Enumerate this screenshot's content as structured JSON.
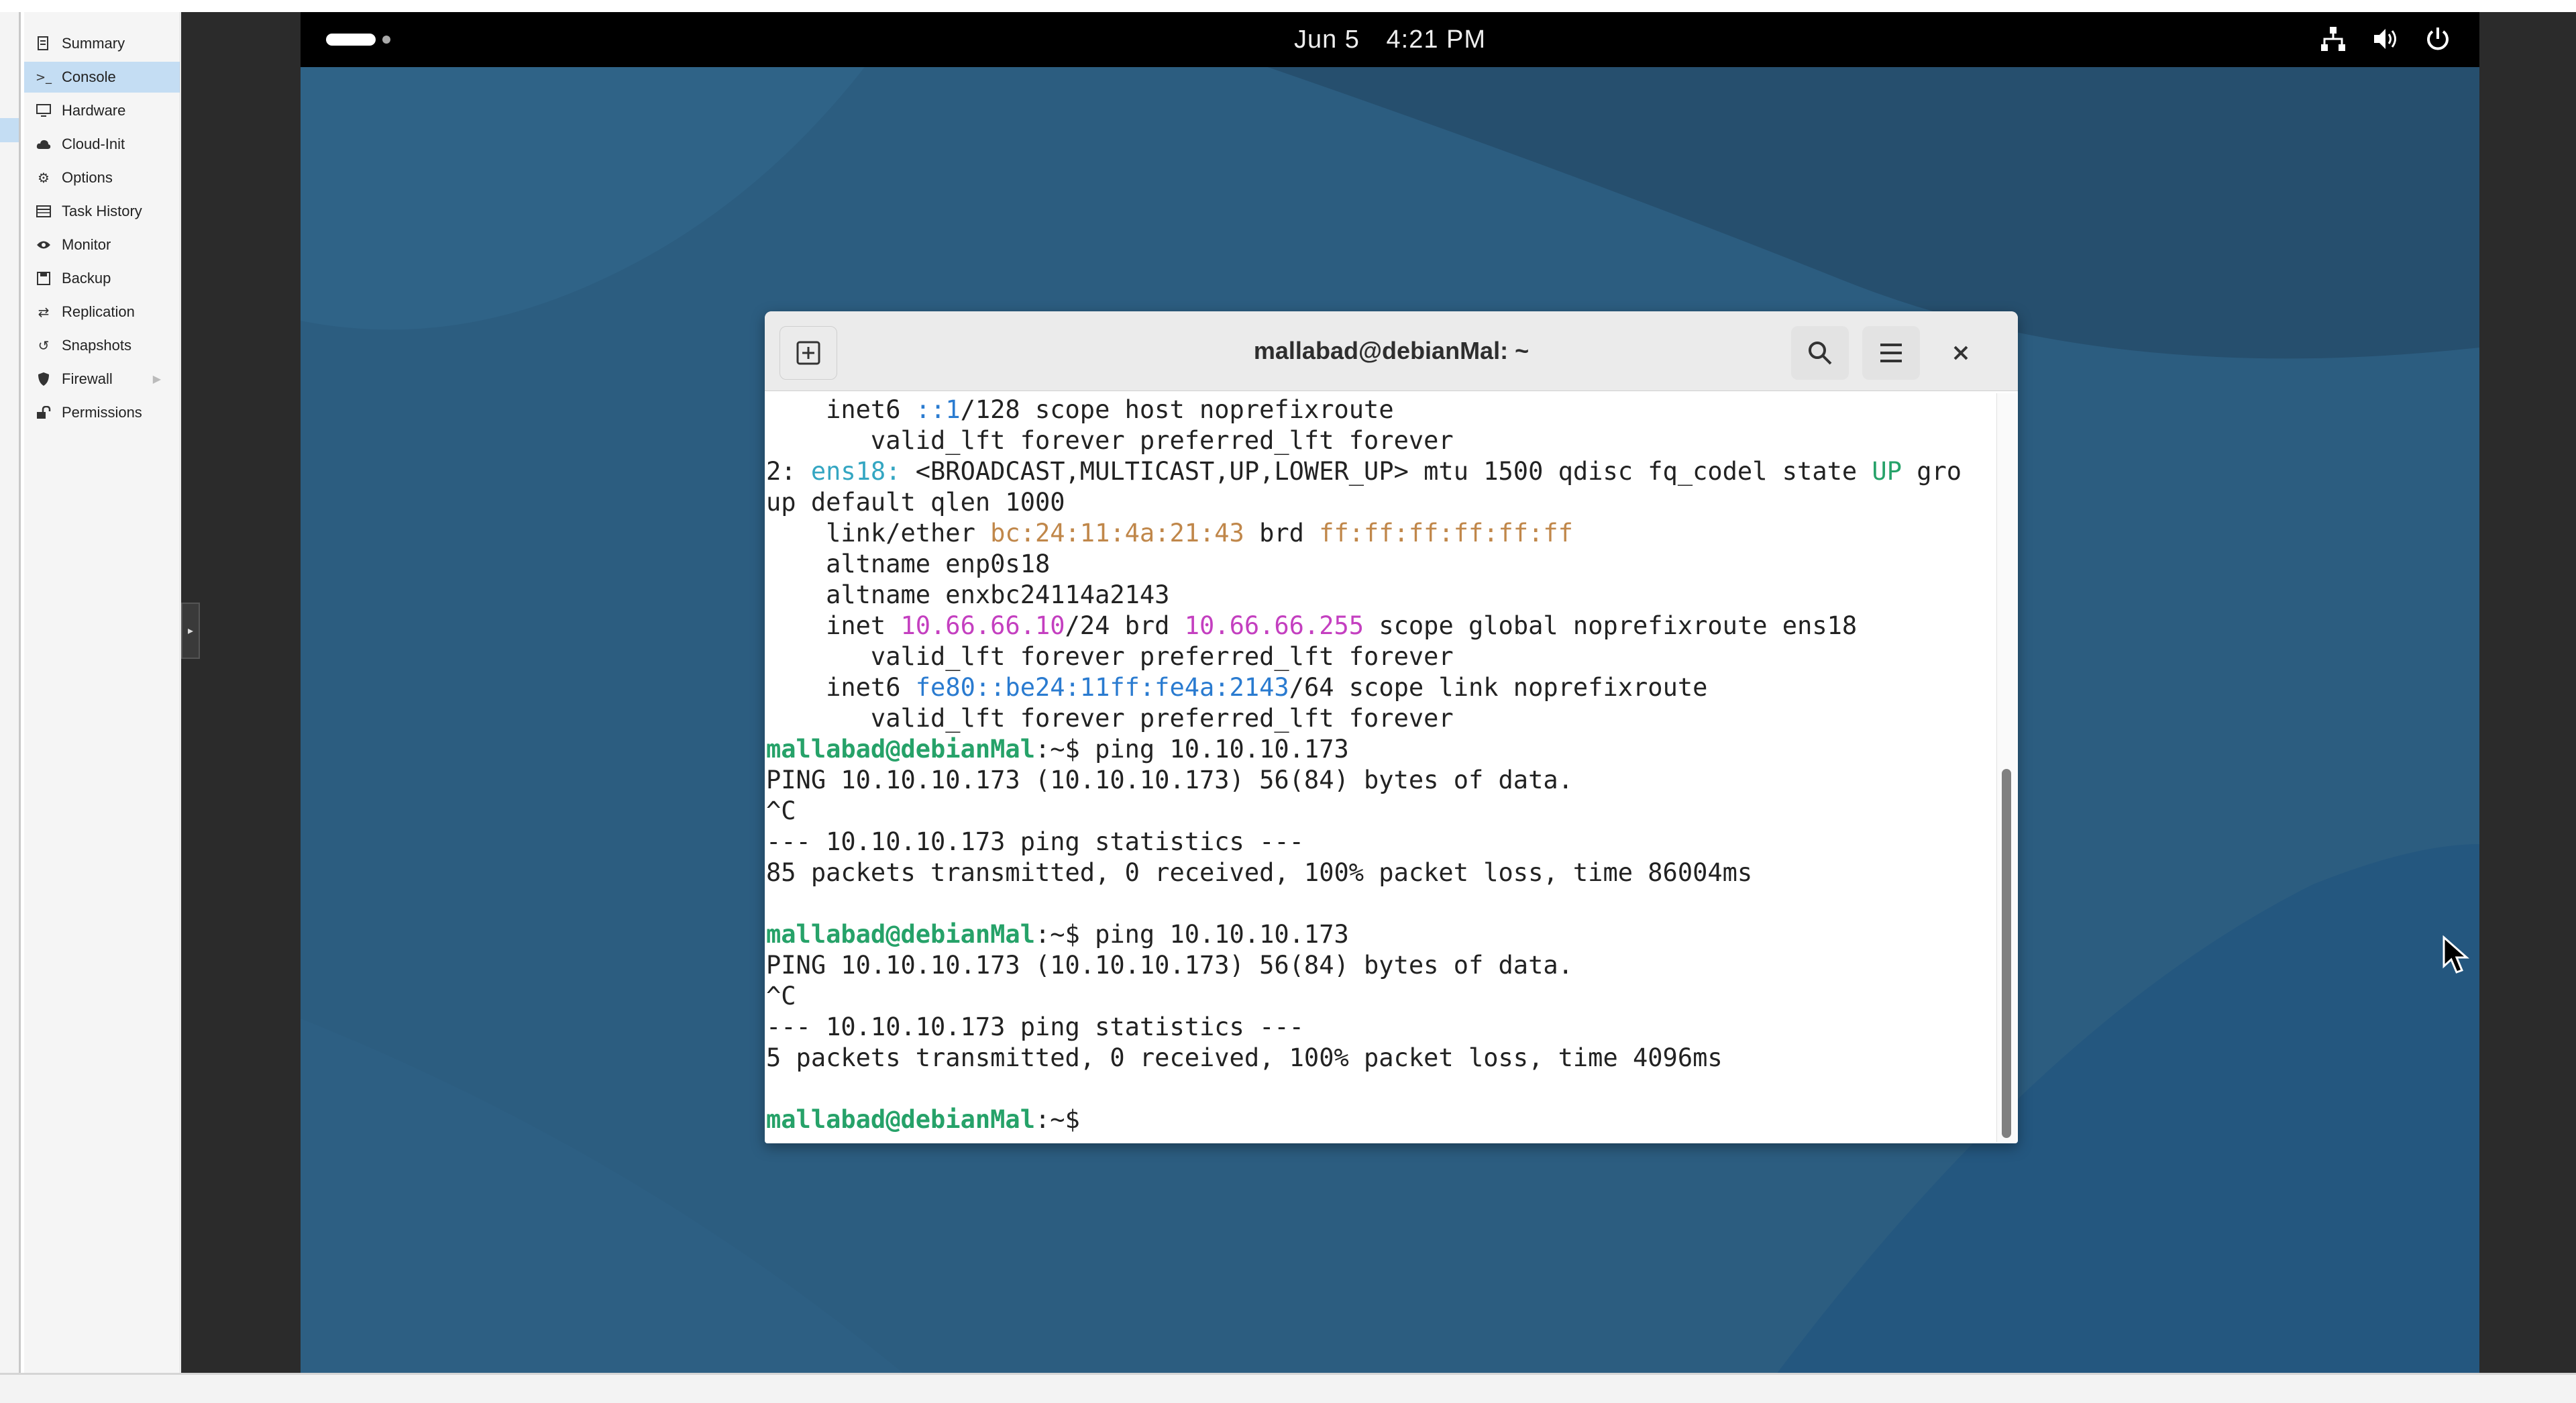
{
  "sidebar": {
    "items": [
      {
        "label": "Summary",
        "icon": "document-icon"
      },
      {
        "label": "Console",
        "icon": "terminal-icon",
        "active": true
      },
      {
        "label": "Hardware",
        "icon": "monitor-icon"
      },
      {
        "label": "Cloud-Init",
        "icon": "cloud-icon"
      },
      {
        "label": "Options",
        "icon": "gear-icon"
      },
      {
        "label": "Task History",
        "icon": "list-icon"
      },
      {
        "label": "Monitor",
        "icon": "eye-icon"
      },
      {
        "label": "Backup",
        "icon": "floppy-icon"
      },
      {
        "label": "Replication",
        "icon": "sync-icon"
      },
      {
        "label": "Snapshots",
        "icon": "history-icon"
      },
      {
        "label": "Firewall",
        "icon": "shield-icon"
      },
      {
        "label": "Permissions",
        "icon": "unlock-icon"
      }
    ]
  },
  "topbar": {
    "date": "Jun 5",
    "time": "4:21 PM"
  },
  "terminal": {
    "title": "mallabad@debianMal: ~",
    "prompt_user": "mallabad@debianMal",
    "prompt_path": ":~$",
    "lines": [
      [
        {
          "t": "    inet6 ",
          "c": "def"
        },
        {
          "t": "::1",
          "c": "blue"
        },
        {
          "t": "/128 scope host noprefixroute",
          "c": "def"
        }
      ],
      [
        {
          "t": "       valid_lft forever preferred_lft forever",
          "c": "def"
        }
      ],
      [
        {
          "t": "2: ",
          "c": "def"
        },
        {
          "t": "ens18:",
          "c": "cyan"
        },
        {
          "t": " <BROADCAST,MULTICAST,UP,LOWER_UP> mtu 1500 qdisc fq_codel state ",
          "c": "def"
        },
        {
          "t": "UP",
          "c": "green"
        },
        {
          "t": " gro",
          "c": "def"
        }
      ],
      [
        {
          "t": "up default qlen 1000",
          "c": "def"
        }
      ],
      [
        {
          "t": "    link/ether ",
          "c": "def"
        },
        {
          "t": "bc:24:11:4a:21:43",
          "c": "brown"
        },
        {
          "t": " brd ",
          "c": "def"
        },
        {
          "t": "ff:ff:ff:ff:ff:ff",
          "c": "brown"
        }
      ],
      [
        {
          "t": "    altname enp0s18",
          "c": "def"
        }
      ],
      [
        {
          "t": "    altname enxbc24114a2143",
          "c": "def"
        }
      ],
      [
        {
          "t": "    inet ",
          "c": "def"
        },
        {
          "t": "10.66.66.10",
          "c": "mag"
        },
        {
          "t": "/24 brd ",
          "c": "def"
        },
        {
          "t": "10.66.66.255",
          "c": "mag"
        },
        {
          "t": " scope global noprefixroute ens18",
          "c": "def"
        }
      ],
      [
        {
          "t": "       valid_lft forever preferred_lft forever",
          "c": "def"
        }
      ],
      [
        {
          "t": "    inet6 ",
          "c": "def"
        },
        {
          "t": "fe80::be24:11ff:fe4a:2143",
          "c": "blue"
        },
        {
          "t": "/64 scope link noprefixroute",
          "c": "def"
        }
      ],
      [
        {
          "t": "       valid_lft forever preferred_lft forever",
          "c": "def"
        }
      ],
      [
        {
          "t": "mallabad@debianMal",
          "c": "prompt"
        },
        {
          "t": ":~$ ping 10.10.10.173",
          "c": "def"
        }
      ],
      [
        {
          "t": "PING 10.10.10.173 (10.10.10.173) 56(84) bytes of data.",
          "c": "def"
        }
      ],
      [
        {
          "t": "^C",
          "c": "def"
        }
      ],
      [
        {
          "t": "--- 10.10.10.173 ping statistics ---",
          "c": "def"
        }
      ],
      [
        {
          "t": "85 packets transmitted, 0 received, 100% packet loss, time 86004ms",
          "c": "def"
        }
      ],
      [
        {
          "t": "",
          "c": "def"
        }
      ],
      [
        {
          "t": "mallabad@debianMal",
          "c": "prompt"
        },
        {
          "t": ":~$ ping 10.10.10.173",
          "c": "def"
        }
      ],
      [
        {
          "t": "PING 10.10.10.173 (10.10.10.173) 56(84) bytes of data.",
          "c": "def"
        }
      ],
      [
        {
          "t": "^C",
          "c": "def"
        }
      ],
      [
        {
          "t": "--- 10.10.10.173 ping statistics ---",
          "c": "def"
        }
      ],
      [
        {
          "t": "5 packets transmitted, 0 received, 100% packet loss, time 4096ms",
          "c": "def"
        }
      ],
      [
        {
          "t": "",
          "c": "def"
        }
      ],
      [
        {
          "t": "mallabad@debianMal",
          "c": "prompt"
        },
        {
          "t": ":~$ ",
          "c": "def"
        }
      ]
    ]
  },
  "colors": {
    "active_menu_bg": "#c4ddf3",
    "prompt_green": "#26a269",
    "interface_cyan": "#34a6c2",
    "ip_magenta": "#c43fc0",
    "mac_brown": "#c0874a",
    "ipv6_blue": "#2a7bd0",
    "desktop_blue": "#2a5a7c"
  }
}
